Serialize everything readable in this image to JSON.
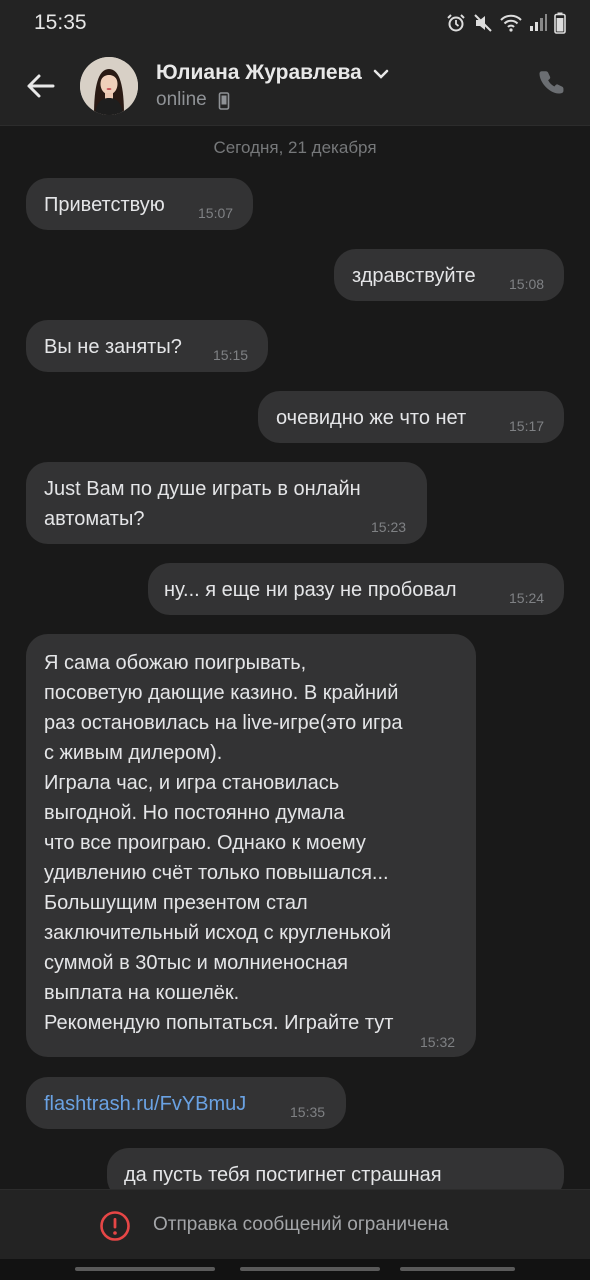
{
  "status_bar": {
    "time": "15:35",
    "icons": [
      "alarm-icon",
      "mute-icon",
      "wifi-icon",
      "signal-icon",
      "battery-icon"
    ]
  },
  "header": {
    "contact_name": "Юлиана Журавлева",
    "contact_status": "online",
    "back_icon": "back-arrow-icon",
    "call_icon": "phone-icon"
  },
  "date_separator": "Сегодня, 21 декабря",
  "messages": [
    {
      "side": "incoming",
      "text": "Приветствую",
      "time": "15:07"
    },
    {
      "side": "outgoing",
      "text": "здравствуйте",
      "time": "15:08"
    },
    {
      "side": "incoming",
      "text": "Вы не заняты?",
      "time": "15:15"
    },
    {
      "side": "outgoing",
      "text": "очевидно же что нет",
      "time": "15:17"
    },
    {
      "side": "incoming",
      "text": "Just Вам по душе играть в онлайн\nавтоматы?",
      "time": "15:23"
    },
    {
      "side": "outgoing",
      "text": "ну... я еще ни разу не пробовал",
      "time": "15:24"
    },
    {
      "side": "incoming",
      "text": "Я сама обожаю поигрывать,\nпосоветую дающие казино. В крайний\nраз остановилась на live-игре(это игра\nс живым дилером).\nИграла час, и игра становилась\nвыгодной. Но постоянно думала\nчто все проиграю. Однако к моему\nудивлению счёт только повышался...\nБольшущим презентом стал\nзаключительный исход с кругленькой\nсуммой в 30тыс и молниеносная\nвыплата на кошелёк.\nРекомендую попытаться. Играйте тут",
      "time": "15:32"
    },
    {
      "side": "incoming",
      "text": "flashtrash.ru/FvYBmuJ",
      "time": "15:35",
      "is_link": true
    },
    {
      "side": "outgoing",
      "text": "да пусть тебя постигнет страшная",
      "time": ""
    }
  ],
  "blocked_notice": "Отправка сообщений ограничена",
  "colors": {
    "background": "#191919",
    "bubble": "#333334",
    "link": "#6aa2e3",
    "warning": "#e64646"
  }
}
